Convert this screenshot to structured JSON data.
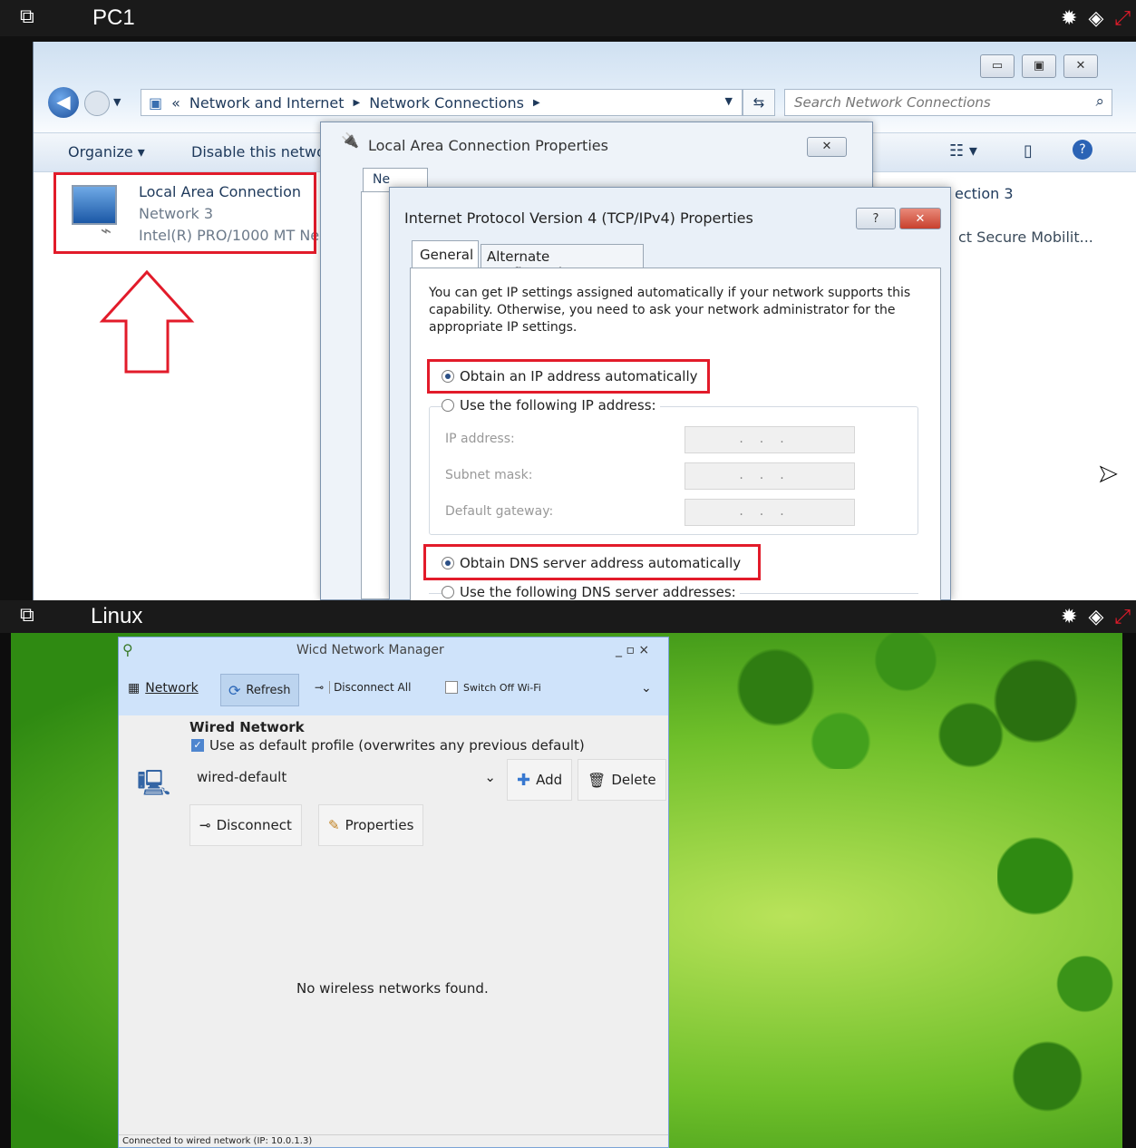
{
  "top_window": {
    "title": "PC1",
    "breadcrumb": {
      "root_sep": "«",
      "items": [
        "Network and Internet",
        "Network Connections"
      ]
    },
    "search_placeholder": "Search Network Connections",
    "toolbar": {
      "organize": "Organize",
      "disable": "Disable this netwo"
    },
    "connection": {
      "name": "Local Area Connection",
      "network": "Network 3",
      "adapter": "Intel(R) PRO/1000 MT Ne"
    },
    "right_item": {
      "name": "ection 3",
      "desc": "ct Secure Mobilit..."
    },
    "lac_dialog": {
      "title": "Local Area Connection Properties",
      "tab_partial": "Ne",
      "close": "✕"
    },
    "ipv4_dialog": {
      "title": "Internet Protocol Version 4 (TCP/IPv4) Properties",
      "help": "?",
      "close": "✕",
      "tabs": [
        "General",
        "Alternate Configuration"
      ],
      "intro": "You can get IP settings assigned automatically if your network supports this capability. Otherwise, you need to ask your network administrator for the appropriate IP settings.",
      "opt_auto_ip": "Obtain an IP address automatically",
      "opt_manual_ip": "Use the following IP address:",
      "ip_label": "IP address:",
      "mask_label": "Subnet mask:",
      "gw_label": "Default gateway:",
      "dots": "...",
      "opt_auto_dns": "Obtain DNS server address automatically",
      "opt_manual_dns": "Use the following DNS server addresses:"
    }
  },
  "bottom_window": {
    "title": "Linux",
    "wicd": {
      "title": "Wicd Network Manager",
      "win_ctrls": "_ ▫ ×",
      "network": "Network",
      "refresh": "Refresh",
      "disconnect_all": "Disconnect All",
      "switch_wifi": "Switch Off Wi-Fi",
      "wired_title": "Wired Network",
      "default_profile": "Use as default profile (overwrites any previous default)",
      "profile": "wired-default",
      "add": "Add",
      "delete": "Delete",
      "disconnect": "Disconnect",
      "properties": "Properties",
      "no_wireless": "No wireless networks found.",
      "status": "Connected to wired network (IP: 10.0.1.3)"
    }
  },
  "colors": {
    "highlight": "#e21b2a",
    "titlebar": "#1a1a1a",
    "wicd_blue": "#cfe3fa"
  }
}
